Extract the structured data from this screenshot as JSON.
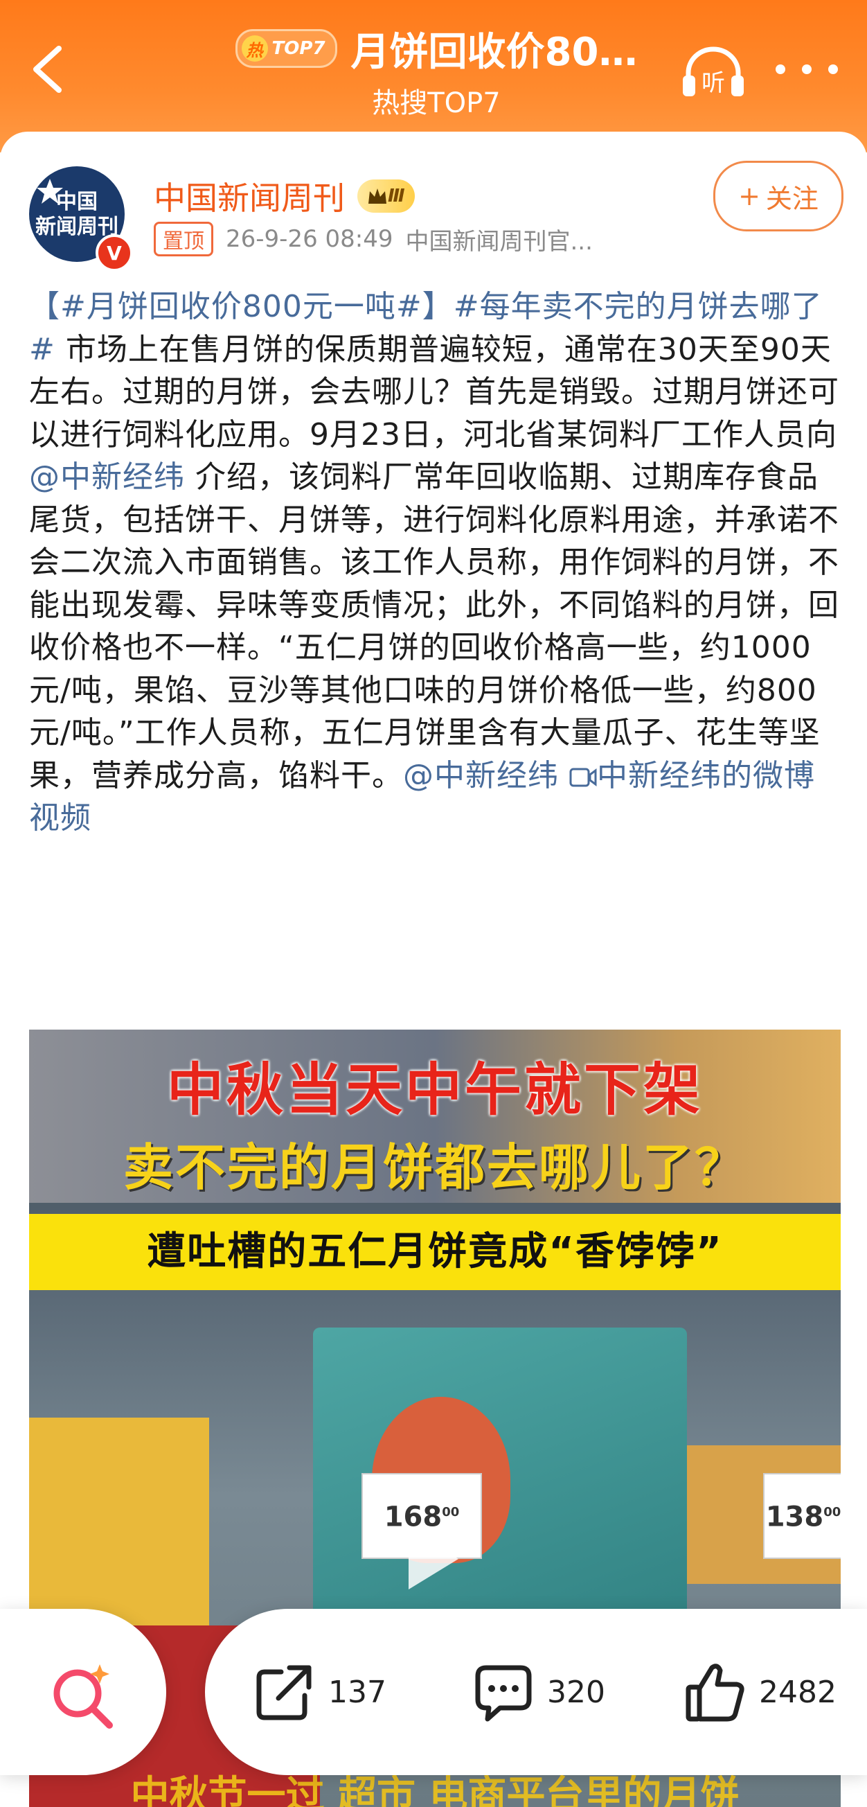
{
  "header": {
    "hot_badge": "热",
    "hot_badge_label": "TOP7",
    "title": "月饼回收价80…",
    "subtitle": "热搜TOP7"
  },
  "post": {
    "author": "中国新闻周刊",
    "level_badge": "Ⅲ",
    "avatar_text_1": "中国",
    "avatar_text_2": "新闻周刊",
    "verified": "V",
    "pinned_label": "置顶",
    "timestamp": "26-9-26 08:49",
    "source": "中国新闻周刊官...",
    "follow_label": "关注",
    "follow_plus": "+",
    "text": {
      "hashtag1": "【#月饼回收价800元一吨#】",
      "hashtag2": "#每年卖不完的月饼去哪了#",
      "body1": " 市场上在售月饼的保质期普遍较短，通常在30天至90天左右。过期的月饼，会去哪儿？首先是销毁。过期月饼还可以进行饲料化应用。9月23日，河北省某饲料厂工作人员向",
      "mention1": "@中新经纬",
      "body2": " 介绍，该饲料厂常年回收临期、过期库存食品尾货，包括饼干、月饼等，进行饲料化原料用途，并承诺不会二次流入市面销售。该工作人员称，用作饲料的月饼，不能出现发霉、异味等变质情况；此外，不同馅料的月饼，回收价格也不一样。“五仁月饼的回收价格高一些，约1000元/吨，果馅、豆沙等其他口味的月饼价格低一些，约800元/吨。”工作人员称，五仁月饼里含有大量瓜子、花生等坚果，营养成分高，馅料干。",
      "mention2": "@中新经纬",
      "video_link": "中新经纬的微博视频"
    }
  },
  "video": {
    "caption1": "中秋当天中午就下架",
    "caption2": "卖不完的月饼都去哪儿了？",
    "caption3": "遭吐槽的五仁月饼竟成“香饽饽”",
    "price1": "168",
    "price1_cents": "00",
    "price2": "138",
    "price2_cents": "00",
    "bottom_caption": "中秋节一过 超市 电商平台里的月饼"
  },
  "actions": {
    "repost_count": "137",
    "comment_count": "320",
    "like_count": "2482"
  }
}
